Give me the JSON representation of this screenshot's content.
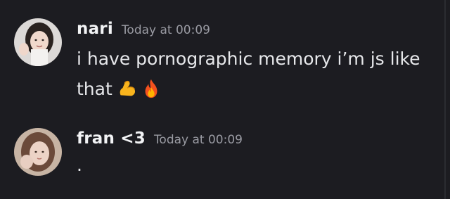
{
  "messages": [
    {
      "username": "nari",
      "timestamp": "Today at 00:09",
      "text_line1": "i have pornographic memory i’m js like",
      "text_line2": "that",
      "emojis": [
        "flexed-biceps-icon",
        "fire-icon"
      ],
      "avatar_colors": {
        "bg": "#d9d6d4",
        "hair": "#2a2320"
      }
    },
    {
      "username": "fran <3",
      "timestamp": "Today at 00:09",
      "text": ".",
      "avatar_colors": {
        "bg": "#c9b6a6",
        "hair": "#6b4a3a"
      }
    }
  ],
  "theme": {
    "background": "#1c1c21",
    "username_color": "#f2f3f5",
    "timestamp_color": "#9a9ba3",
    "text_color": "#e6e7ea"
  }
}
